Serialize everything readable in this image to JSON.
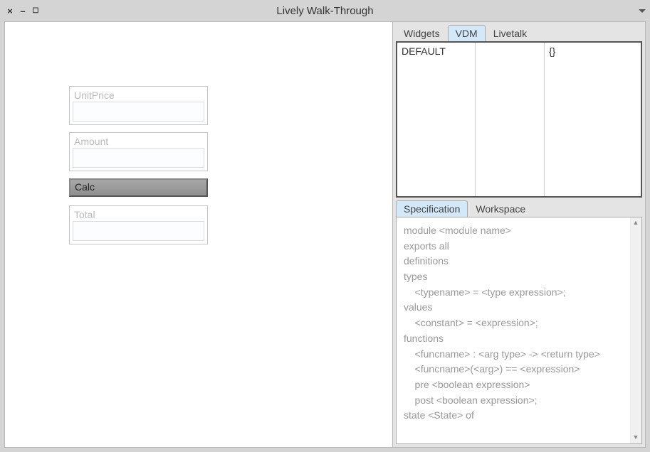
{
  "window": {
    "title": "Lively Walk-Through"
  },
  "form": {
    "unitprice": {
      "label": "UnitPrice",
      "value": ""
    },
    "amount": {
      "label": "Amount",
      "value": ""
    },
    "calc_label": "Calc",
    "total": {
      "label": "Total",
      "value": ""
    }
  },
  "tabs": {
    "items": [
      "Widgets",
      "VDM",
      "Livetalk"
    ],
    "active": "VDM"
  },
  "module_table": {
    "name": "DEFAULT",
    "col2": "",
    "state": "{}"
  },
  "sub_tabs": {
    "items": [
      "Specification",
      "Workspace"
    ],
    "active": "Specification"
  },
  "spec_lines": [
    "module <module name>",
    "exports all",
    "definitions",
    "types",
    "    <typename> = <type expression>;",
    "values",
    "    <constant> = <expression>;",
    "functions",
    "    <funcname> : <arg type> -> <return type>",
    "    <funcname>(<arg>) == <expression>",
    "    pre <boolean expression>",
    "    post <boolean expression>;",
    "state <State> of"
  ]
}
